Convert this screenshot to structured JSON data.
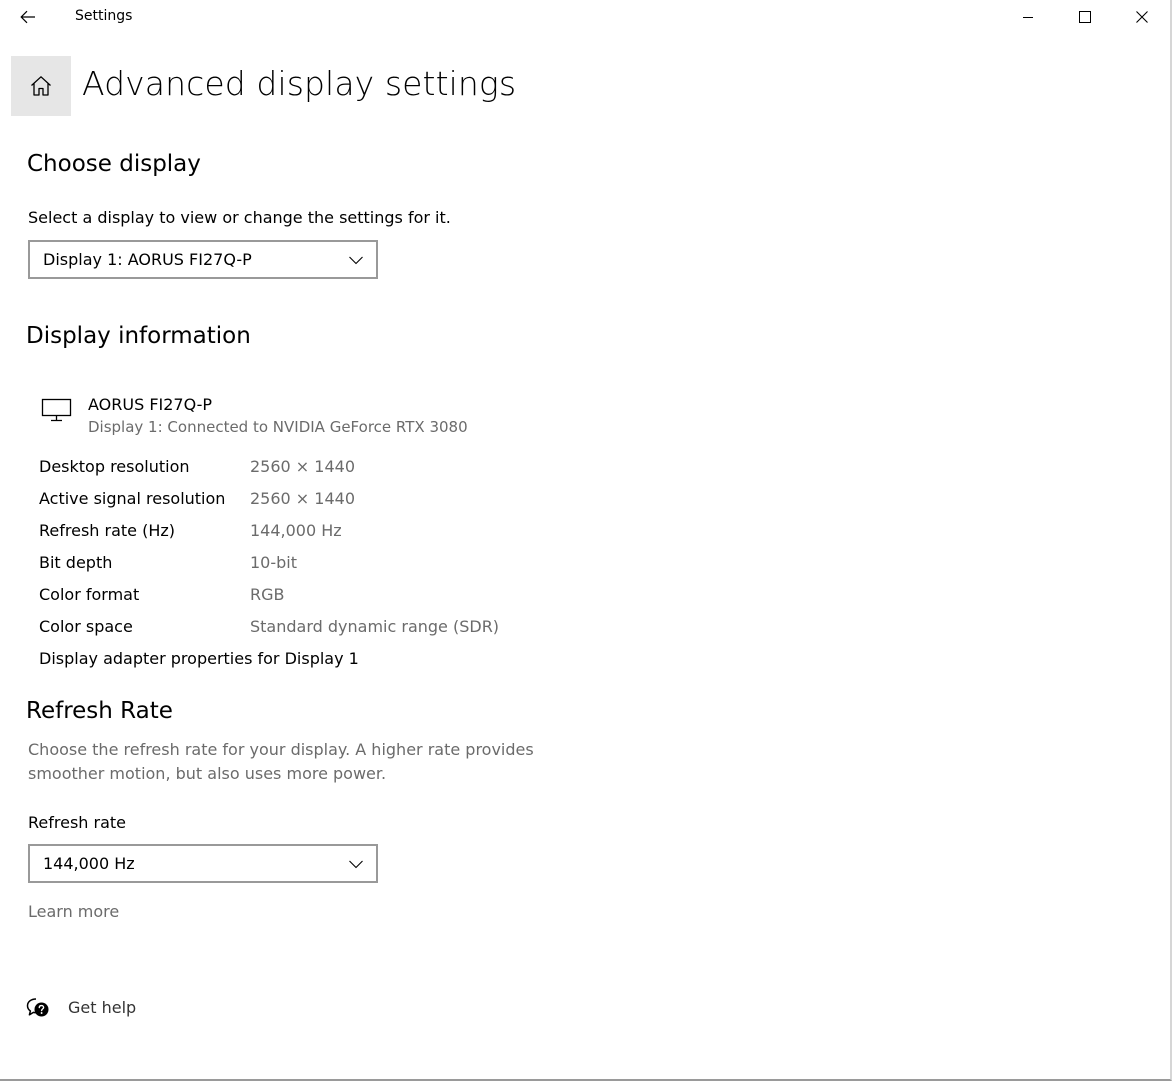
{
  "window": {
    "title": "Settings"
  },
  "header": {
    "title": "Advanced display settings"
  },
  "choose_display": {
    "heading": "Choose display",
    "description": "Select a display to view or change the settings for it.",
    "selected": "Display 1: AORUS FI27Q-P"
  },
  "display_info": {
    "heading": "Display information",
    "monitor_name": "AORUS FI27Q-P",
    "monitor_subtitle": "Display 1: Connected to NVIDIA GeForce RTX 3080",
    "rows": [
      {
        "label": "Desktop resolution",
        "value": "2560 × 1440"
      },
      {
        "label": "Active signal resolution",
        "value": "2560 × 1440"
      },
      {
        "label": "Refresh rate (Hz)",
        "value": "144,000 Hz"
      },
      {
        "label": "Bit depth",
        "value": "10-bit"
      },
      {
        "label": "Color format",
        "value": "RGB"
      },
      {
        "label": "Color space",
        "value": "Standard dynamic range (SDR)"
      }
    ],
    "adapter_link": "Display adapter properties for Display 1"
  },
  "refresh_rate": {
    "heading": "Refresh Rate",
    "description_line1": "Choose the refresh rate for your display. A higher rate provides",
    "description_line2": "smoother motion, but also uses more power.",
    "field_label": "Refresh rate",
    "selected": "144,000 Hz",
    "learn_more": "Learn more"
  },
  "help": {
    "label": "Get help"
  },
  "icons": {
    "back": "back-arrow-icon",
    "minimize": "minimize-icon",
    "maximize": "maximize-icon",
    "close": "close-icon",
    "home": "home-icon",
    "monitor": "monitor-icon",
    "chevron": "chevron-down-icon",
    "help": "help-chat-icon"
  },
  "colors": {
    "home_button_bg": "#e6e6e6",
    "secondary_text": "#6b6b6b",
    "dropdown_border": "#999999"
  }
}
